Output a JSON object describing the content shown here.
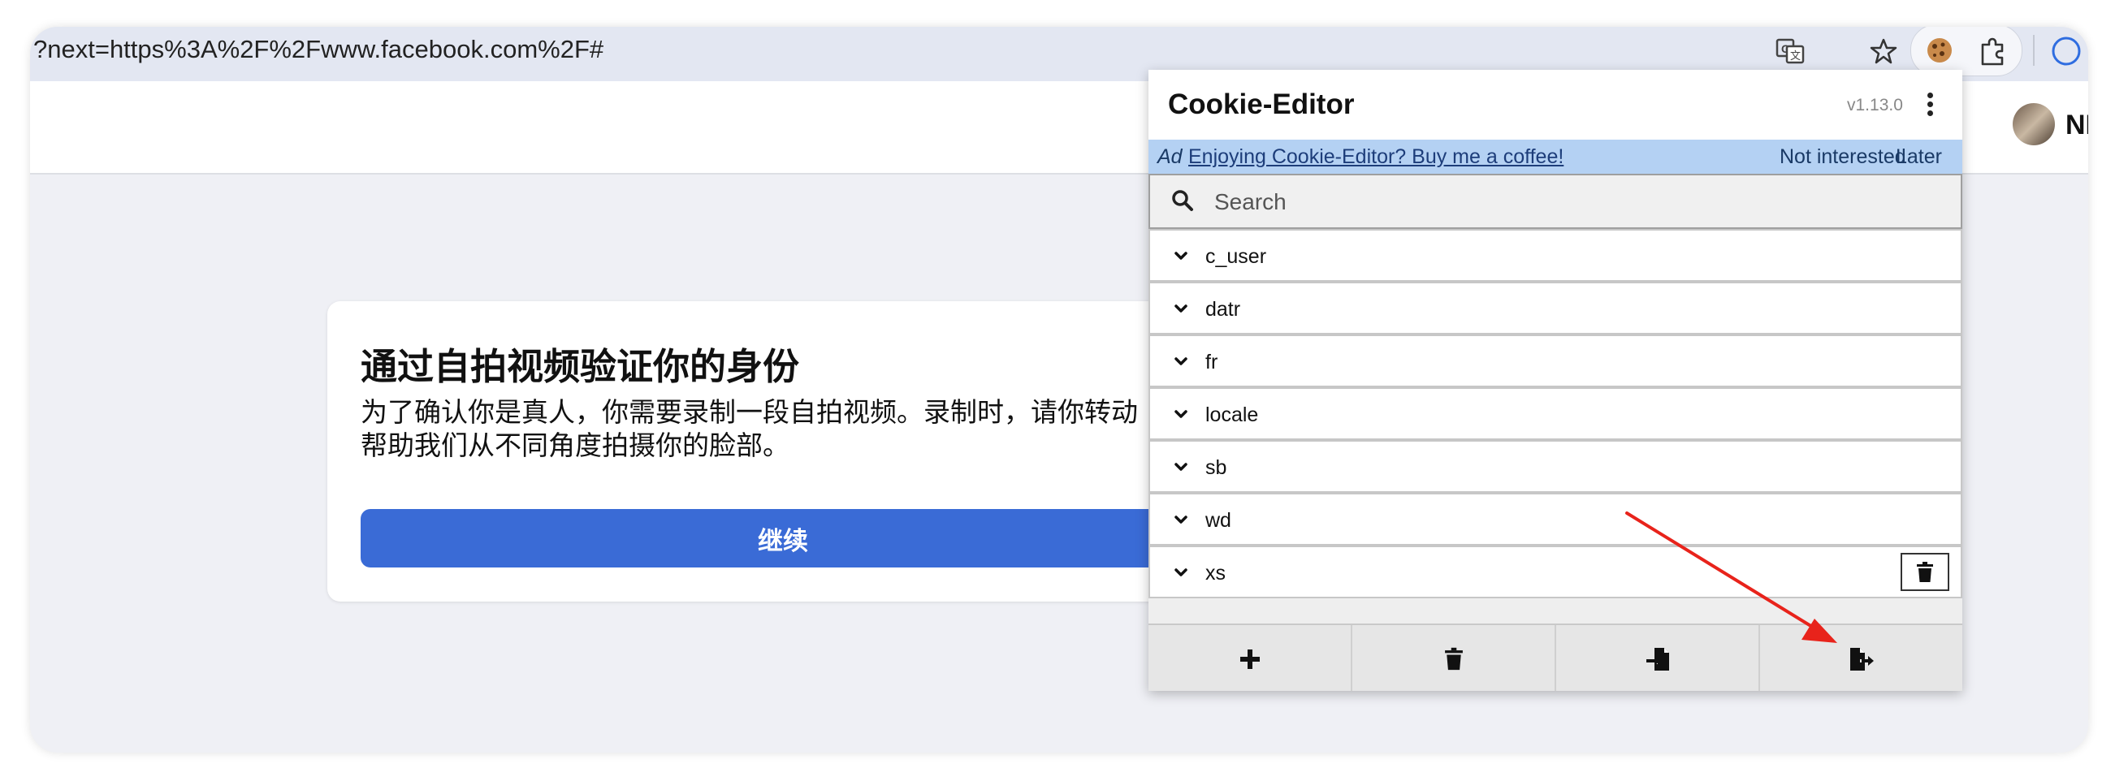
{
  "browser": {
    "url": "?next=https%3A%2F%2Fwww.facebook.com%2F#",
    "icons": [
      "translate-icon",
      "bookmark-star-icon",
      "cookie-extension-icon",
      "extensions-puzzle-icon"
    ]
  },
  "page": {
    "avatar_text": "NI",
    "card": {
      "title": "通过自拍视频验证你的身份",
      "body_line1": "为了确认你是真人，你需要录制一段自拍视频。录制时，请你转动",
      "body_line2": "帮助我们从不同角度拍摄你的脸部。",
      "continue_label": "继续"
    }
  },
  "popup": {
    "title": "Cookie-Editor",
    "version": "v1.13.0",
    "ad": {
      "tag": "Ad",
      "link": "Enjoying Cookie-Editor? Buy me a coffee!",
      "not_interested": "Not interested",
      "later": "Later"
    },
    "search": {
      "placeholder": "Search"
    },
    "cookies": [
      {
        "name": "c_user"
      },
      {
        "name": "datr"
      },
      {
        "name": "fr"
      },
      {
        "name": "locale"
      },
      {
        "name": "sb"
      },
      {
        "name": "wd"
      },
      {
        "name": "xs"
      }
    ],
    "footer_buttons": [
      "add-icon",
      "delete-all-icon",
      "import-icon",
      "export-icon"
    ]
  },
  "colors": {
    "accent_button": "#3a6bd6",
    "ad_bar": "#b4d1f3",
    "annotation_arrow": "#e8231b"
  }
}
